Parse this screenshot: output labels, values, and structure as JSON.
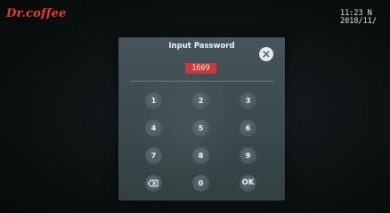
{
  "brand": {
    "logo_text": "Dr.coffee"
  },
  "clock": {
    "time": "11:23 N",
    "date": "2018/11/"
  },
  "dialog": {
    "title": "Input Password",
    "password_value": "1609",
    "keypad": [
      "1",
      "2",
      "3",
      "4",
      "5",
      "6",
      "7",
      "8",
      "9"
    ],
    "zero_label": "0",
    "ok_label": "OK"
  },
  "icons": {
    "close": "close-icon",
    "backspace": "backspace-icon"
  },
  "colors": {
    "brand": "#e8402a",
    "dialog_bg": "#3f4d52",
    "key_bg": "#4d5c61",
    "password_bg": "#c93a3c"
  }
}
